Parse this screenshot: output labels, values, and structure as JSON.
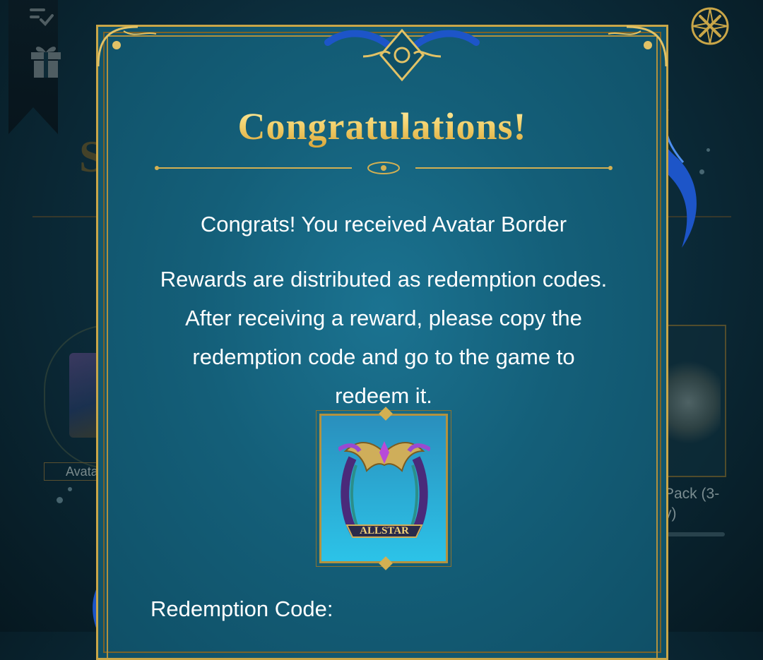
{
  "background": {
    "left_item_label": "Avata",
    "right_item_label_line1": "Pack (3-",
    "right_item_label_line2": "y)",
    "partial_letter": "S"
  },
  "modal": {
    "title": "Congratulations!",
    "headline": "Congrats! You received Avatar Border",
    "body_lines": [
      "Rewards are distributed as redemption codes.",
      "After receiving a reward, please copy the",
      "redemption code and go to the game to",
      "redeem it."
    ],
    "reward": {
      "name": "Avatar Border",
      "badge_text": "ALLSTAR"
    },
    "code_label": "Redemption Code:"
  },
  "icons": [
    "check-list-icon",
    "gift-icon",
    "close-icon"
  ],
  "colors": {
    "gold": "#c9a648",
    "modal_bg": "#145f79",
    "title_gold": "#f2cf6a",
    "tentacle_blue": "#1b4fb8"
  }
}
